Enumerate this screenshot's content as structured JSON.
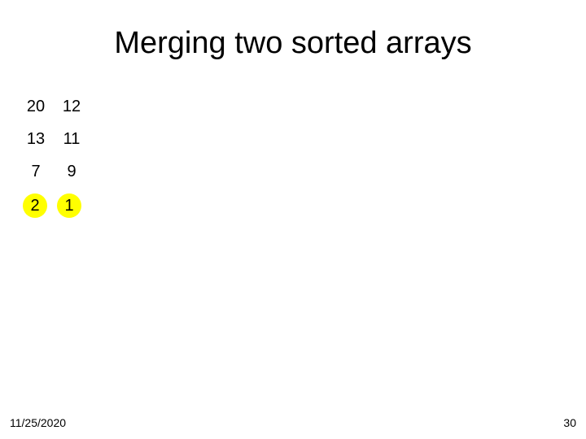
{
  "title": "Merging two sorted arrays",
  "arrays": {
    "left": [
      "20",
      "13",
      "7",
      "2"
    ],
    "right": [
      "12",
      "11",
      "9",
      "1"
    ]
  },
  "highlight": {
    "leftIndex": 3,
    "rightIndex": 3
  },
  "footer": {
    "date": "11/25/2020",
    "slideNumber": "30"
  }
}
